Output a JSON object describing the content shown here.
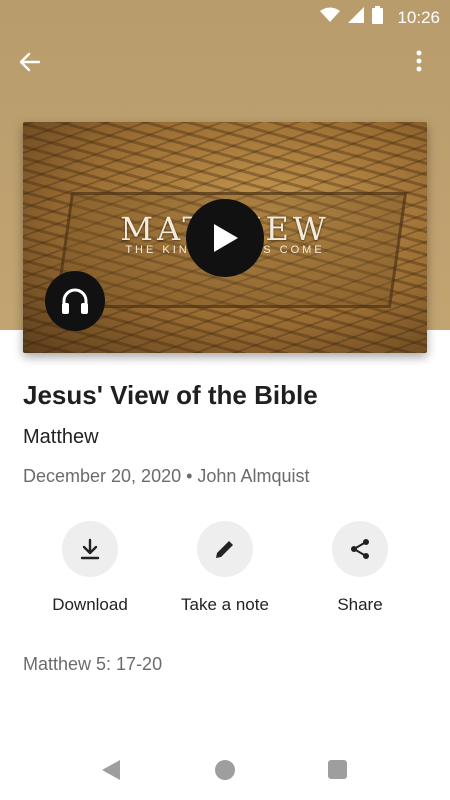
{
  "status_bar": {
    "time": "10:26"
  },
  "toolbar": {
    "back_icon": "arrow-left-icon",
    "menu_icon": "more-vert-icon"
  },
  "artwork": {
    "title": "MATTHEW",
    "subtitle": "THE KINGDOM HAS COME",
    "play_icon": "play-icon",
    "audio_icon": "headphones-icon"
  },
  "sermon": {
    "title": "Jesus' View of the Bible",
    "series": "Matthew",
    "meta": "December 20, 2020 • John Almquist",
    "scripture": "Matthew 5: 17-20"
  },
  "actions": [
    {
      "label": "Download",
      "icon": "download-icon"
    },
    {
      "label": "Take a note",
      "icon": "pencil-icon"
    },
    {
      "label": "Share",
      "icon": "share-icon"
    }
  ],
  "colors": {
    "header": "#c2a471",
    "dark_button": "#111111",
    "action_circle": "#eeeeee"
  }
}
